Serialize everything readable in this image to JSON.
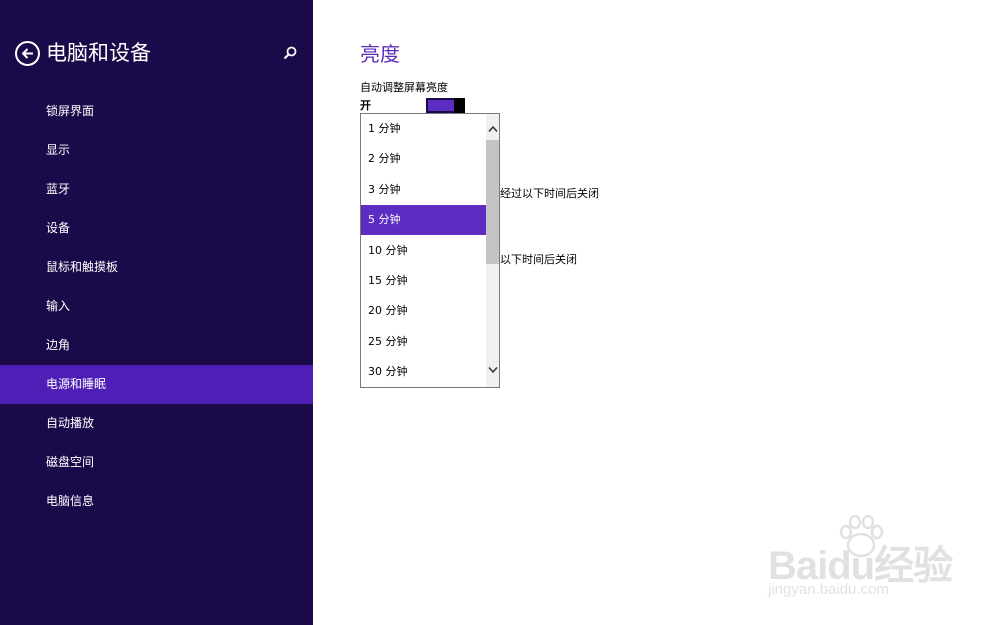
{
  "sidebar": {
    "title": "电脑和设备",
    "items": [
      {
        "label": "锁屏界面"
      },
      {
        "label": "显示"
      },
      {
        "label": "蓝牙"
      },
      {
        "label": "设备"
      },
      {
        "label": "鼠标和触摸板"
      },
      {
        "label": "输入"
      },
      {
        "label": "边角"
      },
      {
        "label": "电源和睡眠",
        "active": true
      },
      {
        "label": "自动播放"
      },
      {
        "label": "磁盘空间"
      },
      {
        "label": "电脑信息"
      }
    ]
  },
  "main": {
    "section_title": "亮度",
    "auto_brightness_label": "自动调整屏幕亮度",
    "toggle_state": "开",
    "toggle_on": true,
    "partial_label_1": "经过以下时间后关闭",
    "partial_label_2": "以下时间后关闭"
  },
  "dropdown": {
    "options": [
      "1 分钟",
      "2 分钟",
      "3 分钟",
      "5 分钟",
      "10 分钟",
      "15 分钟",
      "20 分钟",
      "25 分钟",
      "30 分钟"
    ],
    "selected": "5 分钟"
  },
  "watermark": {
    "text": "Baidu经验",
    "subtext": "jingyan.baidu.com"
  },
  "colors": {
    "sidebar_bg": "#1a0a4a",
    "accent": "#4e1fb6",
    "title": "#5b2db8"
  },
  "icons": [
    "back-arrow-icon",
    "search-icon",
    "chevron-up-icon",
    "chevron-down-icon"
  ]
}
